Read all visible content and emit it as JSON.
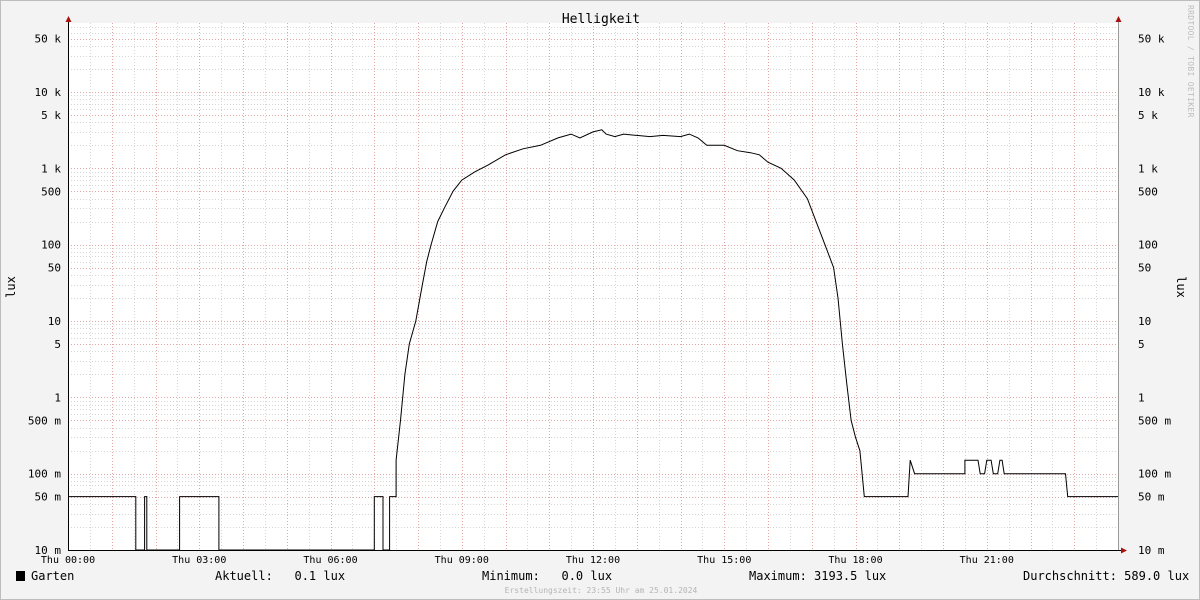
{
  "chart_data": {
    "type": "line",
    "title": "Helligkeit",
    "ylabel": "lux",
    "yscale": "log",
    "ylim": [
      0.01,
      80000
    ],
    "xlim": [
      0,
      24
    ],
    "grid": true,
    "y_ticks": [
      {
        "value": 50000,
        "label": "50 k"
      },
      {
        "value": 10000,
        "label": "10 k"
      },
      {
        "value": 5000,
        "label": "5 k"
      },
      {
        "value": 1000,
        "label": "1 k"
      },
      {
        "value": 500,
        "label": "500"
      },
      {
        "value": 100,
        "label": "100"
      },
      {
        "value": 50,
        "label": "50"
      },
      {
        "value": 10,
        "label": "10"
      },
      {
        "value": 5,
        "label": "5"
      },
      {
        "value": 1,
        "label": "1"
      },
      {
        "value": 0.5,
        "label": "500 m"
      },
      {
        "value": 0.1,
        "label": "100 m"
      },
      {
        "value": 0.05,
        "label": "50 m"
      },
      {
        "value": 0.01,
        "label": "10 m"
      }
    ],
    "x_ticks": [
      {
        "value": 0,
        "label": "Thu 00:00"
      },
      {
        "value": 3,
        "label": "Thu 03:00"
      },
      {
        "value": 6,
        "label": "Thu 06:00"
      },
      {
        "value": 9,
        "label": "Thu 09:00"
      },
      {
        "value": 12,
        "label": "Thu 12:00"
      },
      {
        "value": 15,
        "label": "Thu 15:00"
      },
      {
        "value": 18,
        "label": "Thu 18:00"
      },
      {
        "value": 21,
        "label": "Thu 21:00"
      }
    ],
    "series": [
      {
        "name": "Garten",
        "color": "#000000",
        "points": [
          [
            0.0,
            0.05
          ],
          [
            1.55,
            0.05
          ],
          [
            1.55,
            0.01
          ],
          [
            1.75,
            0.01
          ],
          [
            1.75,
            0.05
          ],
          [
            1.8,
            0.05
          ],
          [
            1.8,
            0.01
          ],
          [
            2.55,
            0.01
          ],
          [
            2.55,
            0.05
          ],
          [
            3.45,
            0.05
          ],
          [
            3.45,
            0.01
          ],
          [
            7.0,
            0.01
          ],
          [
            7.0,
            0.05
          ],
          [
            7.2,
            0.05
          ],
          [
            7.2,
            0.01
          ],
          [
            7.35,
            0.01
          ],
          [
            7.35,
            0.05
          ],
          [
            7.5,
            0.05
          ],
          [
            7.5,
            0.15
          ],
          [
            7.6,
            0.5
          ],
          [
            7.7,
            2
          ],
          [
            7.8,
            5
          ],
          [
            7.95,
            10
          ],
          [
            8.1,
            30
          ],
          [
            8.2,
            60
          ],
          [
            8.3,
            100
          ],
          [
            8.45,
            200
          ],
          [
            8.6,
            300
          ],
          [
            8.8,
            500
          ],
          [
            9.0,
            700
          ],
          [
            9.3,
            900
          ],
          [
            9.6,
            1100
          ],
          [
            10.0,
            1500
          ],
          [
            10.4,
            1800
          ],
          [
            10.8,
            2000
          ],
          [
            11.2,
            2500
          ],
          [
            11.5,
            2800
          ],
          [
            11.7,
            2500
          ],
          [
            12.0,
            3000
          ],
          [
            12.2,
            3190
          ],
          [
            12.3,
            2800
          ],
          [
            12.5,
            2600
          ],
          [
            12.7,
            2800
          ],
          [
            13.0,
            2700
          ],
          [
            13.3,
            2600
          ],
          [
            13.6,
            2700
          ],
          [
            14.0,
            2600
          ],
          [
            14.2,
            2800
          ],
          [
            14.4,
            2500
          ],
          [
            14.6,
            2000
          ],
          [
            15.0,
            2000
          ],
          [
            15.3,
            1700
          ],
          [
            15.6,
            1600
          ],
          [
            15.8,
            1500
          ],
          [
            16.0,
            1200
          ],
          [
            16.3,
            1000
          ],
          [
            16.6,
            700
          ],
          [
            16.9,
            400
          ],
          [
            17.1,
            200
          ],
          [
            17.3,
            100
          ],
          [
            17.5,
            50
          ],
          [
            17.6,
            20
          ],
          [
            17.7,
            5
          ],
          [
            17.8,
            1.5
          ],
          [
            17.9,
            0.5
          ],
          [
            18.0,
            0.3
          ],
          [
            18.1,
            0.2
          ],
          [
            18.2,
            0.05
          ],
          [
            19.2,
            0.05
          ],
          [
            19.25,
            0.15
          ],
          [
            19.35,
            0.1
          ],
          [
            20.0,
            0.1
          ],
          [
            20.5,
            0.1
          ],
          [
            20.5,
            0.15
          ],
          [
            20.8,
            0.15
          ],
          [
            20.85,
            0.1
          ],
          [
            20.95,
            0.1
          ],
          [
            21.0,
            0.15
          ],
          [
            21.1,
            0.15
          ],
          [
            21.15,
            0.1
          ],
          [
            21.25,
            0.1
          ],
          [
            21.3,
            0.15
          ],
          [
            21.35,
            0.15
          ],
          [
            21.4,
            0.1
          ],
          [
            22.8,
            0.1
          ],
          [
            22.85,
            0.05
          ],
          [
            24.0,
            0.05
          ]
        ]
      }
    ],
    "legend": {
      "label": "Garten",
      "current": "Aktuell:   0.1 lux",
      "minimum": "Minimum:   0.0 lux",
      "maximum": "Maximum: 3193.5 lux",
      "average": "Durchschnitt: 589.0 lux"
    }
  },
  "footer": "Erstellungszeit: 23:55 Uhr am 25.01.2024",
  "watermark": "RRDTOOL / TOBI OETIKER"
}
